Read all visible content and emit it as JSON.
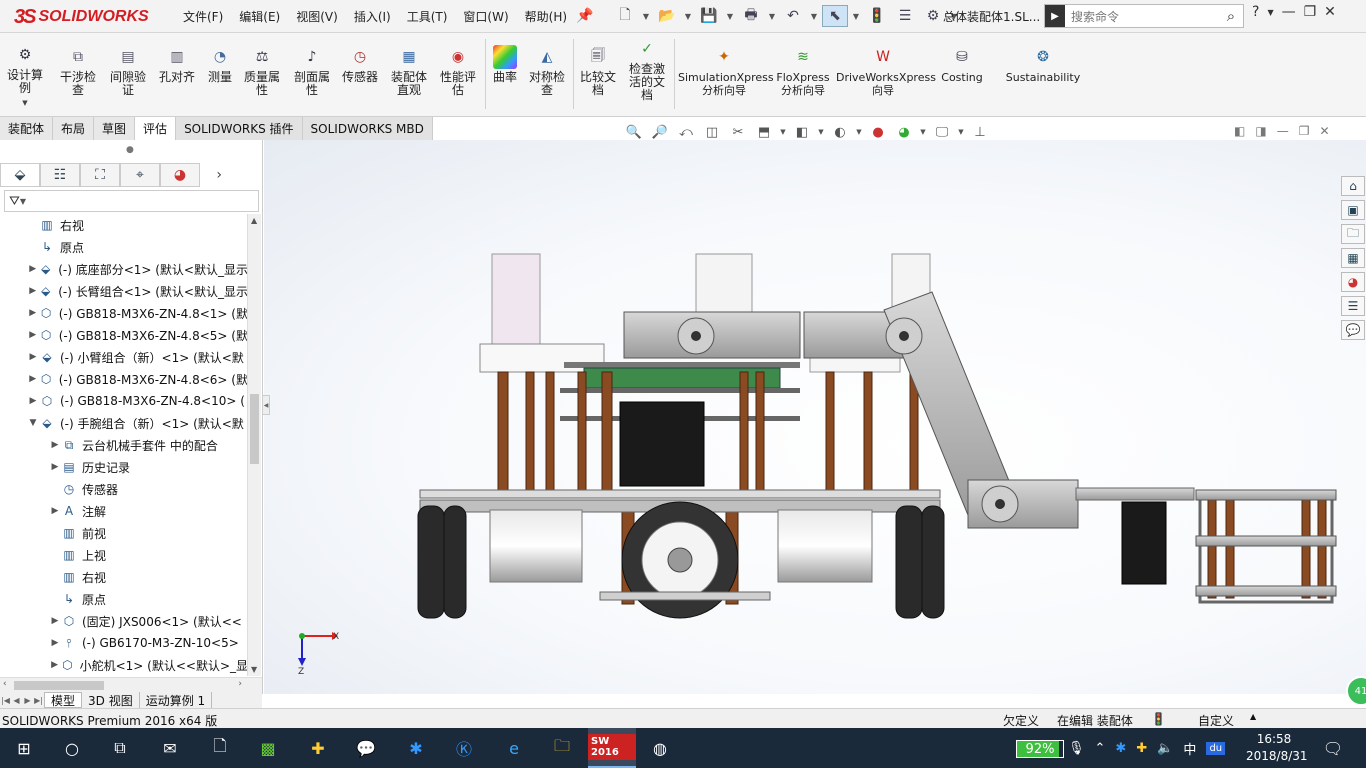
{
  "app": {
    "logo_text": "SOLIDWORKS",
    "logo_mark": "3S",
    "document_title": "总体装配体1.SL...",
    "menus": [
      "文件(F)",
      "编辑(E)",
      "视图(V)",
      "插入(I)",
      "工具(T)",
      "窗口(W)",
      "帮助(H)"
    ],
    "search_placeholder": "搜索命令",
    "help_icon": "?"
  },
  "ribbon": {
    "buttons": [
      {
        "label": "设计算例",
        "icon": "design-study-icon"
      },
      {
        "label": "干涉检查",
        "icon": "interference-check-icon"
      },
      {
        "label": "间隙验证",
        "icon": "clearance-verification-icon"
      },
      {
        "label": "孔对齐",
        "icon": "hole-alignment-icon"
      },
      {
        "label": "测量",
        "icon": "measure-icon"
      },
      {
        "label": "质量属性",
        "icon": "mass-properties-icon"
      },
      {
        "label": "剖面属性",
        "icon": "section-properties-icon"
      },
      {
        "label": "传感器",
        "icon": "sensor-icon"
      },
      {
        "label": "装配体直观",
        "icon": "assembly-visualization-icon"
      },
      {
        "label": "性能评估",
        "icon": "performance-evaluation-icon"
      },
      {
        "label": "曲率",
        "icon": "curvature-icon"
      },
      {
        "label": "对称检查",
        "icon": "symmetry-check-icon"
      },
      {
        "label": "比较文档",
        "icon": "compare-documents-icon"
      },
      {
        "label": "检查激活的文档",
        "icon": "check-active-document-icon"
      },
      {
        "label": "SimulationXpress分析向导",
        "icon": "simulationxpress-icon"
      },
      {
        "label": "FloXpress分析向导",
        "icon": "floxpress-icon"
      },
      {
        "label": "DriveWorksXpress向导",
        "icon": "driveworksxpress-icon"
      },
      {
        "label": "Costing",
        "icon": "costing-icon"
      },
      {
        "label": "Sustainability",
        "icon": "sustainability-icon"
      }
    ]
  },
  "command_tabs": [
    "装配体",
    "布局",
    "草图",
    "评估",
    "SOLIDWORKS 插件",
    "SOLIDWORKS MBD"
  ],
  "active_tab": "评估",
  "feature_tree": {
    "items": [
      {
        "label": "右视",
        "level": 1,
        "expand": "",
        "icon": "plane-icon"
      },
      {
        "label": "原点",
        "level": 1,
        "expand": "",
        "icon": "origin-icon"
      },
      {
        "label": "(-) 底座部分<1> (默认<默认_显示",
        "level": 1,
        "expand": "▶",
        "icon": "subassembly-icon"
      },
      {
        "label": "(-) 长臂组合<1> (默认<默认_显示",
        "level": 1,
        "expand": "▶",
        "icon": "subassembly-icon"
      },
      {
        "label": "(-) GB818-M3X6-ZN-4.8<1> (默",
        "level": 1,
        "expand": "▶",
        "icon": "part-icon"
      },
      {
        "label": "(-) GB818-M3X6-ZN-4.8<5> (默",
        "level": 1,
        "expand": "▶",
        "icon": "part-icon"
      },
      {
        "label": "(-) 小臂组合（新）<1> (默认<默",
        "level": 1,
        "expand": "▶",
        "icon": "subassembly-icon"
      },
      {
        "label": "(-) GB818-M3X6-ZN-4.8<6> (默",
        "level": 1,
        "expand": "▶",
        "icon": "part-icon"
      },
      {
        "label": "(-) GB818-M3X6-ZN-4.8<10> (",
        "level": 1,
        "expand": "▶",
        "icon": "part-icon"
      },
      {
        "label": "(-) 手腕组合（新）<1> (默认<默",
        "level": 1,
        "expand": "▼",
        "icon": "subassembly-icon"
      },
      {
        "label": "云台机械手套件 中的配合",
        "level": 2,
        "expand": "▶",
        "icon": "mates-icon"
      },
      {
        "label": "历史记录",
        "level": 2,
        "expand": "▶",
        "icon": "history-icon"
      },
      {
        "label": "传感器",
        "level": 2,
        "expand": "",
        "icon": "sensor-icon"
      },
      {
        "label": "注解",
        "level": 2,
        "expand": "▶",
        "icon": "annotation-icon"
      },
      {
        "label": "前视",
        "level": 2,
        "expand": "",
        "icon": "plane-icon"
      },
      {
        "label": "上视",
        "level": 2,
        "expand": "",
        "icon": "plane-icon"
      },
      {
        "label": "右视",
        "level": 2,
        "expand": "",
        "icon": "plane-icon"
      },
      {
        "label": "原点",
        "level": 2,
        "expand": "",
        "icon": "origin-icon"
      },
      {
        "label": "(固定) JXS006<1> (默认<<",
        "level": 2,
        "expand": "▶",
        "icon": "part-icon"
      },
      {
        "label": "(-) GB6170-M3-ZN-10<5>",
        "level": 2,
        "expand": "▶",
        "icon": "screw-icon"
      },
      {
        "label": "小舵机<1> (默认<<默认>_显",
        "level": 2,
        "expand": "▶",
        "icon": "part-icon"
      }
    ]
  },
  "bottom_tabs": [
    "模型",
    "3D 视图",
    "运动算例 1"
  ],
  "active_bottom_tab": "模型",
  "status": {
    "product": "SOLIDWORKS Premium 2016 x64 版",
    "defined": "欠定义",
    "editing": "在编辑 装配体",
    "units": "自定义"
  },
  "triad": {
    "x": "X",
    "y": "Y",
    "z": "Z"
  },
  "badge": "41",
  "taskbar": {
    "sw_label": "SW 2016",
    "battery": "92%",
    "battery_level": 0.92,
    "ime": "中",
    "du": "du",
    "time": "16:58",
    "date": "2018/8/31"
  },
  "colors": {
    "brand_red": "#d31d23",
    "taskbar_bg": "#1b2a3a",
    "ribbon_bg": "#f5f5f5"
  }
}
